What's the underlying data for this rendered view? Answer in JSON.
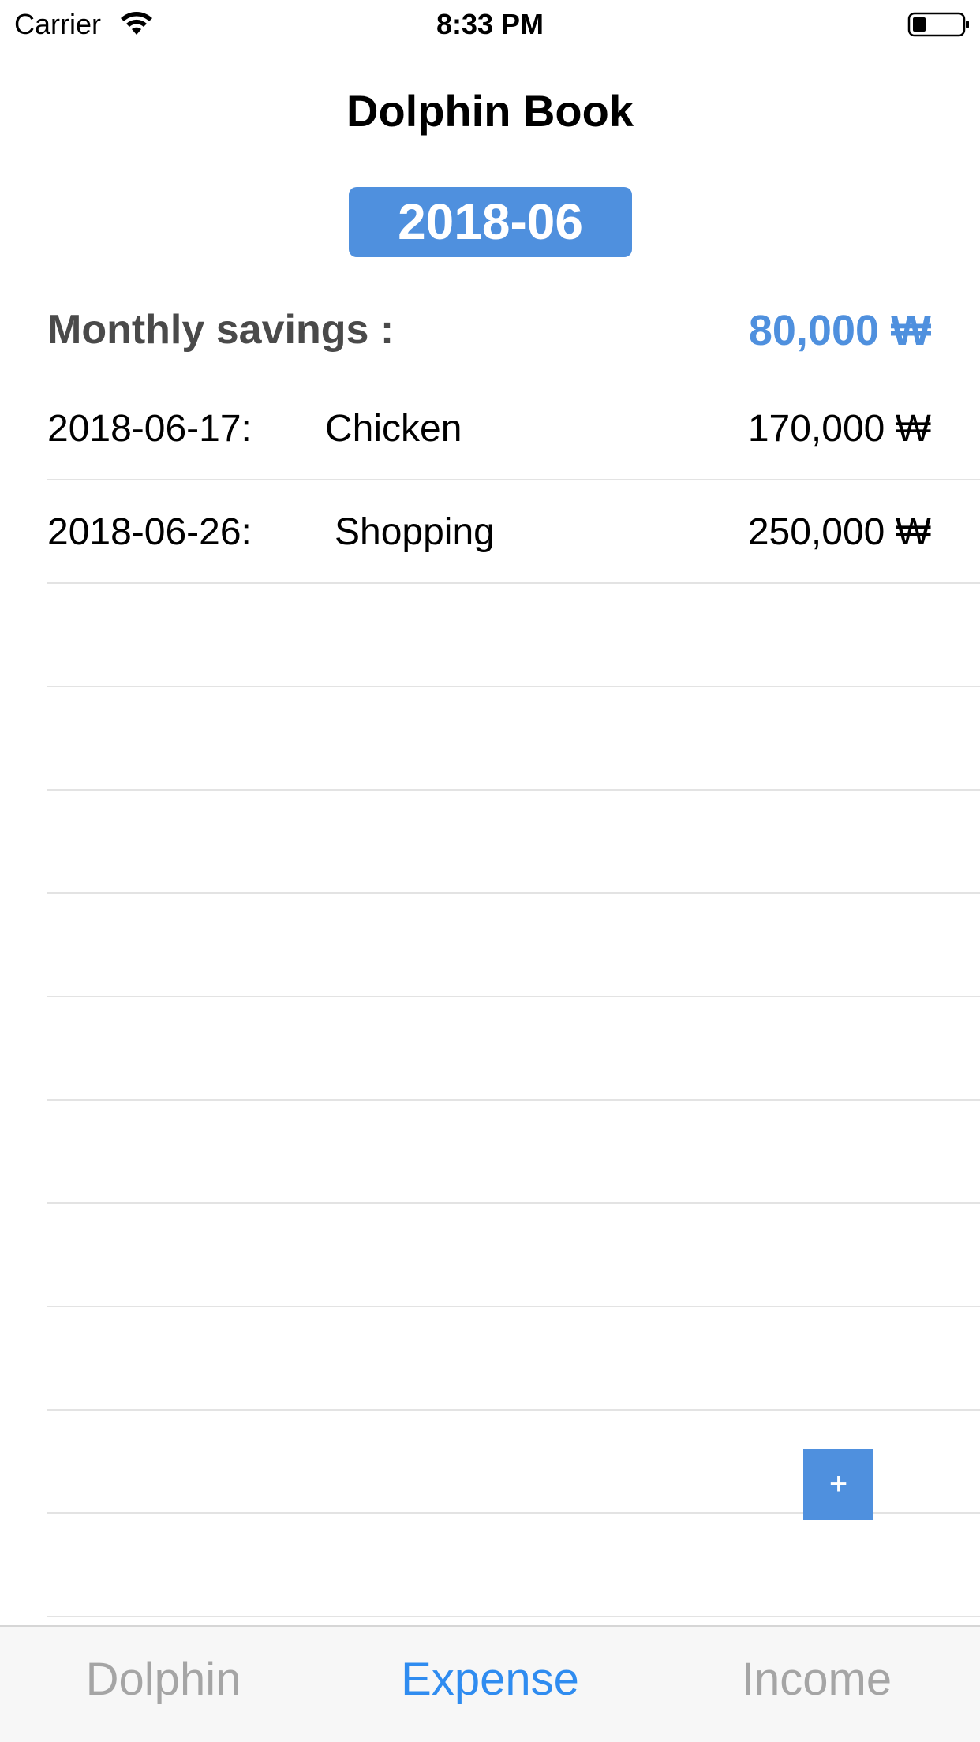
{
  "status_bar": {
    "carrier": "Carrier",
    "time": "8:33 PM"
  },
  "header": {
    "title": "Dolphin Book",
    "month": "2018-06"
  },
  "summary": {
    "label": "Monthly savings :",
    "value": "80,000 ₩"
  },
  "expenses": [
    {
      "date": "2018-06-17:",
      "description": "Chicken",
      "amount": "170,000 ₩"
    },
    {
      "date": "2018-06-26:",
      "description": "Shopping",
      "amount": "250,000 ₩"
    }
  ],
  "add_button": {
    "label": "+"
  },
  "tabs": [
    {
      "label": "Dolphin",
      "active": false
    },
    {
      "label": "Expense",
      "active": true
    },
    {
      "label": "Income",
      "active": false
    }
  ],
  "colors": {
    "accent": "#4f90de",
    "tab_active": "#2f8cf0",
    "tab_inactive": "#a5a5a5"
  }
}
